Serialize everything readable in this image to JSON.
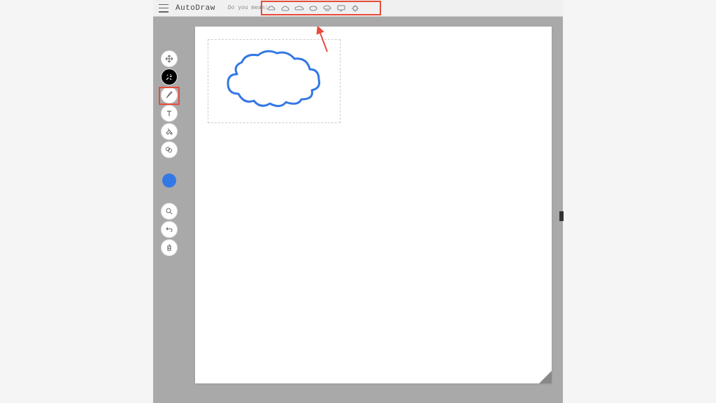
{
  "header": {
    "app_title": "AutoDraw",
    "hint_label": "Do you mean:",
    "suggestions": [
      {
        "name": "cloud-outline-1"
      },
      {
        "name": "cloud-puffy"
      },
      {
        "name": "cloud-simple"
      },
      {
        "name": "thought-bubble"
      },
      {
        "name": "rain-cloud"
      },
      {
        "name": "speech-bubble"
      },
      {
        "name": "gear-outline"
      }
    ]
  },
  "toolbar": {
    "tools": [
      {
        "name": "move-tool",
        "active": false
      },
      {
        "name": "autodraw-tool",
        "active": true
      },
      {
        "name": "draw-tool",
        "active": false
      },
      {
        "name": "text-tool",
        "active": false
      },
      {
        "name": "fill-tool",
        "active": false
      },
      {
        "name": "shape-tool",
        "active": false
      }
    ],
    "color": "#3478e5",
    "bottom_tools": [
      {
        "name": "zoom-tool"
      },
      {
        "name": "undo-tool"
      },
      {
        "name": "delete-tool"
      }
    ]
  },
  "annotations": {
    "highlight_suggestions": true,
    "highlight_autodraw_tool": true,
    "arrow_color": "#e74c3c",
    "stroke_color": "#3478e5"
  }
}
